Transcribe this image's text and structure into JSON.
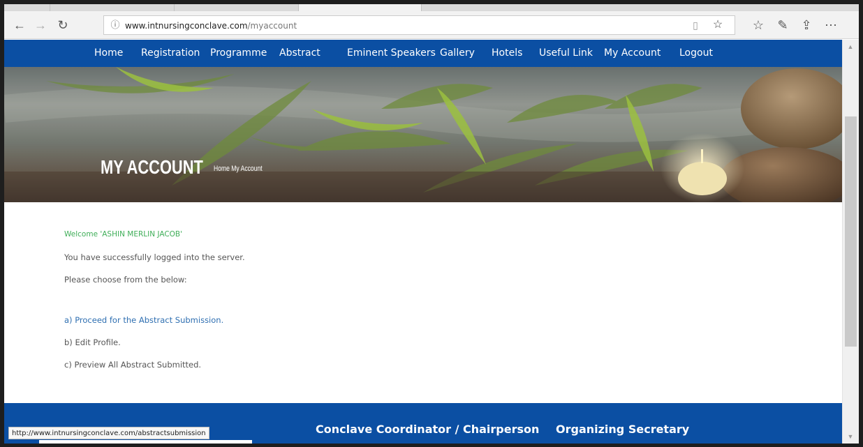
{
  "browser": {
    "url_host": "www.intnursingconclave.com",
    "url_path": "/myaccount",
    "status_link": "http://www.intnursingconclave.com/abstractsubmission"
  },
  "nav": {
    "items": [
      "Home",
      "Registration",
      "Programme",
      "Abstract",
      "Eminent Speakers",
      "Gallery",
      "Hotels",
      "Useful Link",
      "My Account",
      "Logout"
    ]
  },
  "hero": {
    "title": "MY ACCOUNT",
    "breadcrumb_home": "Home",
    "breadcrumb_current": "My Account"
  },
  "content": {
    "welcome": "Welcome 'ASHIN MERLIN JACOB'",
    "logged_in": "You have successfully logged into the server.",
    "choose": "Please choose from the below:",
    "option_a": "a) Proceed for the Abstract Submission.",
    "option_b": "b) Edit Profile.",
    "option_c": "c) Preview All Abstract Submitted."
  },
  "footer": {
    "col1": "Conclave Coordinator / Chairperson",
    "col2": "Organizing Secretary"
  },
  "colors": {
    "nav_bg": "#0b4fa3",
    "welcome": "#3fae58",
    "link": "#2f6fb1"
  }
}
